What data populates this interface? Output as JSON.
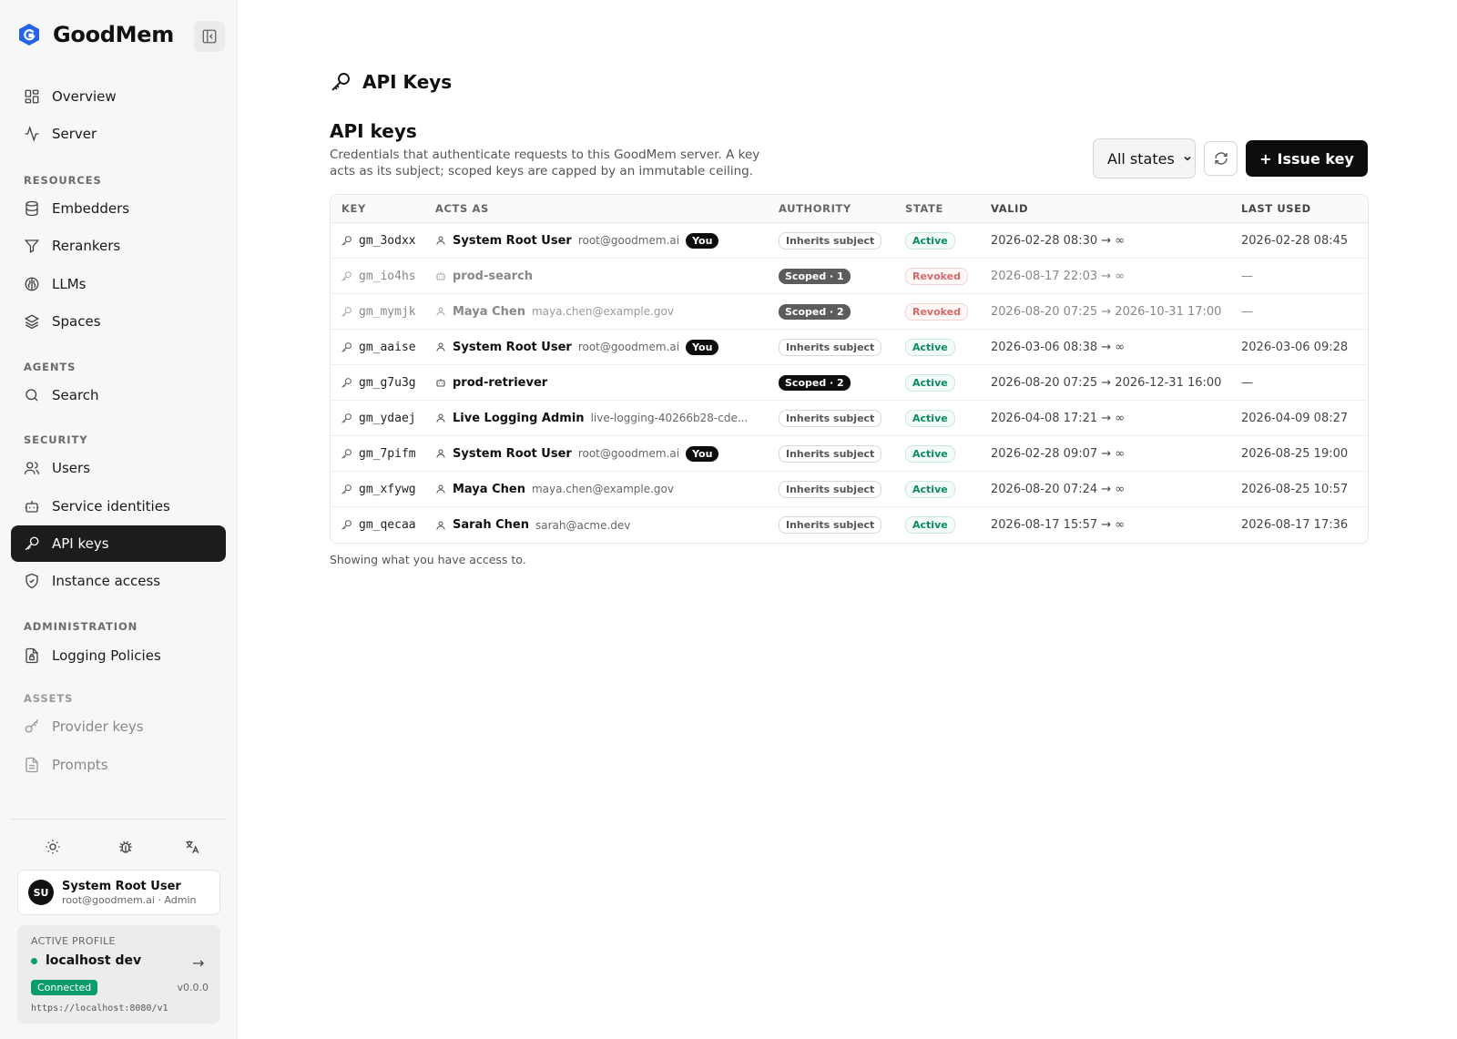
{
  "app": {
    "name": "GoodMem"
  },
  "nav": {
    "top": [
      {
        "label": "Overview",
        "icon": "grid-icon"
      },
      {
        "label": "Server",
        "icon": "activity-icon"
      }
    ],
    "resources_label": "RESOURCES",
    "resources": [
      {
        "label": "Embedders",
        "icon": "database-icon"
      },
      {
        "label": "Rerankers",
        "icon": "filter-icon"
      },
      {
        "label": "LLMs",
        "icon": "brain-icon"
      },
      {
        "label": "Spaces",
        "icon": "layers-icon"
      }
    ],
    "agents_label": "AGENTS",
    "agents": [
      {
        "label": "Search",
        "icon": "search-icon"
      }
    ],
    "security_label": "SECURITY",
    "security": [
      {
        "label": "Users",
        "icon": "users-icon"
      },
      {
        "label": "Service identities",
        "icon": "bot-icon"
      },
      {
        "label": "API keys",
        "icon": "key-icon",
        "active": true
      },
      {
        "label": "Instance access",
        "icon": "shield-icon"
      }
    ],
    "administration_label": "ADMINISTRATION",
    "administration": [
      {
        "label": "Logging Policies",
        "icon": "file-lock-icon"
      }
    ],
    "assets_label": "ASSETS",
    "assets": [
      {
        "label": "Provider keys",
        "icon": "key-round-icon"
      },
      {
        "label": "Prompts",
        "icon": "file-text-icon"
      }
    ]
  },
  "user": {
    "initials": "SU",
    "name": "System Root User",
    "sub": "root@goodmem.ai · Admin"
  },
  "profile": {
    "label": "ACTIVE PROFILE",
    "name": "localhost dev",
    "status": "Connected",
    "version": "v0.0.0",
    "url": "https://localhost:8080/v1"
  },
  "page": {
    "title": "API Keys",
    "section_title": "API keys",
    "description": "Credentials that authenticate requests to this GoodMem server. A key acts as its subject; scoped keys are capped by an immutable ceiling.",
    "filter_value": "All states",
    "issue_label": "Issue key",
    "footnote": "Showing what you have access to."
  },
  "table": {
    "headers": {
      "key": "KEY",
      "acts_as": "ACTS AS",
      "authority": "AUTHORITY",
      "state": "STATE",
      "valid": "VALID",
      "last_used": "LAST USED"
    },
    "rows": [
      {
        "key": "gm_3odxx",
        "subject_type": "user",
        "name": "System Root User",
        "email": "root@goodmem.ai",
        "you": "You",
        "authority": "Inherits subject",
        "authority_kind": "inherit",
        "state": "Active",
        "valid": "2026-02-28 08:30 → ∞",
        "last_used": "2026-02-28 08:45"
      },
      {
        "key": "gm_io4hs",
        "subject_type": "service",
        "name": "prod-search",
        "email": "",
        "you": "",
        "authority": "Scoped · 1",
        "authority_kind": "scoped-grey",
        "state": "Revoked",
        "valid": "2026-08-17 22:03 → ∞",
        "last_used": "—"
      },
      {
        "key": "gm_mymjk",
        "subject_type": "user",
        "name": "Maya Chen",
        "email": "maya.chen@example.gov",
        "you": "",
        "authority": "Scoped · 2",
        "authority_kind": "scoped-grey",
        "state": "Revoked",
        "valid": "2026-08-20 07:25 → 2026-10-31 17:00",
        "last_used": "—"
      },
      {
        "key": "gm_aaise",
        "subject_type": "user",
        "name": "System Root User",
        "email": "root@goodmem.ai",
        "you": "You",
        "authority": "Inherits subject",
        "authority_kind": "inherit",
        "state": "Active",
        "valid": "2026-03-06 08:38 → ∞",
        "last_used": "2026-03-06 09:28"
      },
      {
        "key": "gm_g7u3g",
        "subject_type": "service",
        "name": "prod-retriever",
        "email": "",
        "you": "",
        "authority": "Scoped · 2",
        "authority_kind": "scoped-dark",
        "state": "Active",
        "valid": "2026-08-20 07:25 → 2026-12-31 16:00",
        "last_used": "—"
      },
      {
        "key": "gm_ydaej",
        "subject_type": "user",
        "name": "Live Logging Admin",
        "email": "live-logging-40266b28-cde...",
        "you": "",
        "authority": "Inherits subject",
        "authority_kind": "inherit",
        "state": "Active",
        "valid": "2026-04-08 17:21 → ∞",
        "last_used": "2026-04-09 08:27"
      },
      {
        "key": "gm_7pifm",
        "subject_type": "user",
        "name": "System Root User",
        "email": "root@goodmem.ai",
        "you": "You",
        "authority": "Inherits subject",
        "authority_kind": "inherit",
        "state": "Active",
        "valid": "2026-02-28 09:07 → ∞",
        "last_used": "2026-08-25 19:00"
      },
      {
        "key": "gm_xfywg",
        "subject_type": "user",
        "name": "Maya Chen",
        "email": "maya.chen@example.gov",
        "you": "",
        "authority": "Inherits subject",
        "authority_kind": "inherit",
        "state": "Active",
        "valid": "2026-08-20 07:24 → ∞",
        "last_used": "2026-08-25 10:57"
      },
      {
        "key": "gm_qecaa",
        "subject_type": "user",
        "name": "Sarah Chen",
        "email": "sarah@acme.dev",
        "you": "",
        "authority": "Inherits subject",
        "authority_kind": "inherit",
        "state": "Active",
        "valid": "2026-08-17 15:57 → ∞",
        "last_used": "2026-08-17 17:36"
      }
    ]
  },
  "colors": {
    "accent": "#0d0d0d",
    "success": "#0a9c6c",
    "revoked": "#d46a6a",
    "brand": "#2563eb"
  }
}
